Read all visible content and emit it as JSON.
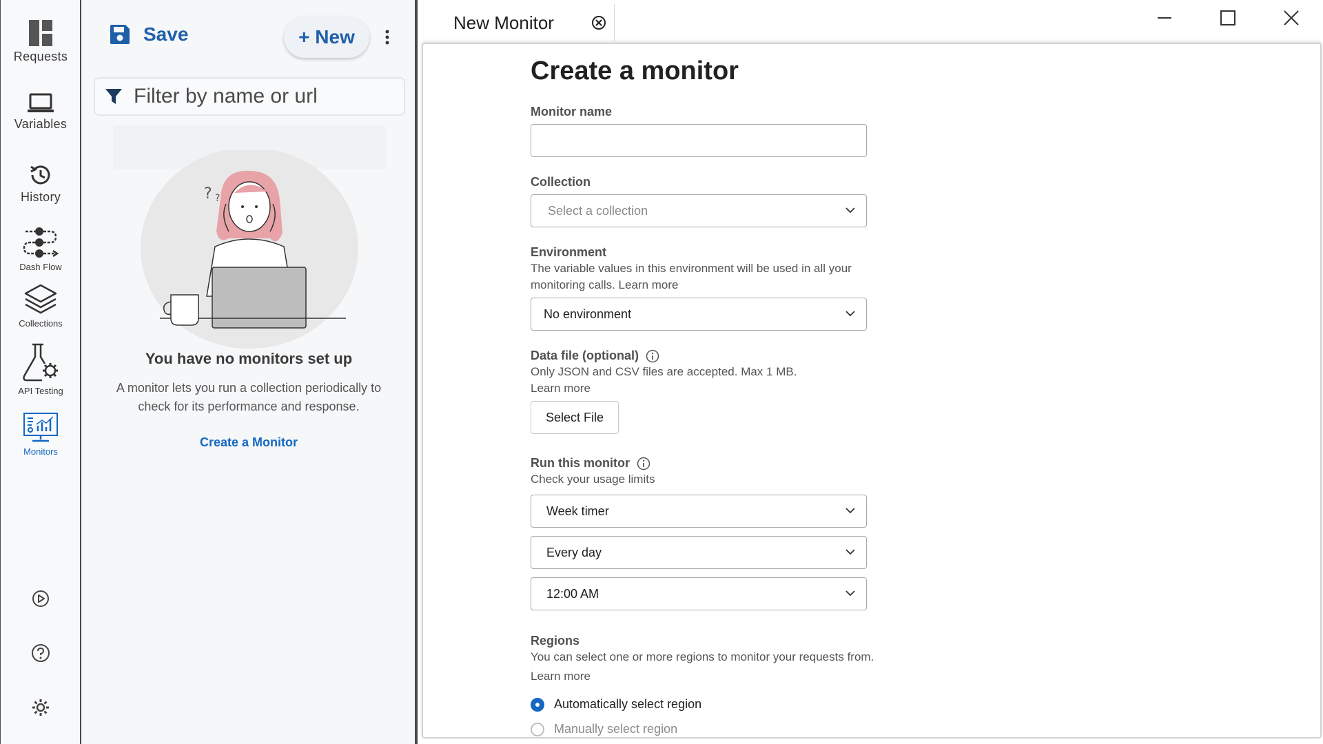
{
  "rail": {
    "items": [
      {
        "label": "Requests",
        "icon": "requests-icon"
      },
      {
        "label": "Variables",
        "icon": "laptop-icon"
      },
      {
        "label": "History",
        "icon": "history-icon"
      },
      {
        "label": "Dash Flow",
        "icon": "flow-icon"
      },
      {
        "label": "Collections",
        "icon": "layers-icon"
      },
      {
        "label": "API Testing",
        "icon": "flask-gear-icon"
      },
      {
        "label": "Monitors",
        "icon": "monitor-chart-icon",
        "active": true
      }
    ],
    "bottom_icons": [
      "play-circle-icon",
      "help-circle-icon",
      "settings-gear-icon"
    ]
  },
  "panel": {
    "save_label": "Save",
    "new_label": "+ New",
    "filter_placeholder": "Filter by name or url",
    "empty_title": "You have no monitors set up",
    "empty_desc": "A monitor lets you run a collection periodically to check for its performance and response.",
    "create_link": "Create a Monitor"
  },
  "tab": {
    "title": "New Monitor"
  },
  "form": {
    "title": "Create a monitor",
    "monitor_name": {
      "label": "Monitor name",
      "value": ""
    },
    "collection": {
      "label": "Collection",
      "placeholder": "Select a collection"
    },
    "environment": {
      "label": "Environment",
      "hint": "The variable values in this environment will be used in all your monitoring calls. Learn more",
      "value": "No environment"
    },
    "data_file": {
      "label": "Data file (optional)",
      "hint": "Only JSON and CSV files are accepted. Max 1 MB. Learn more",
      "button": "Select File"
    },
    "run": {
      "label": "Run this monitor",
      "hint": "Check your usage limits",
      "timer": "Week timer",
      "frequency": "Every day",
      "time": "12:00 AM"
    },
    "regions": {
      "label": "Regions",
      "hint": "You can select one or more regions to monitor your requests from. Learn more",
      "options": [
        {
          "label": "Automatically select region",
          "selected": true
        },
        {
          "label": "Manually select region",
          "selected": false
        }
      ]
    }
  },
  "colors": {
    "accent": "#1467c3",
    "save_blue": "#1f5fa8",
    "panel_bg": "#f6f7f9"
  }
}
